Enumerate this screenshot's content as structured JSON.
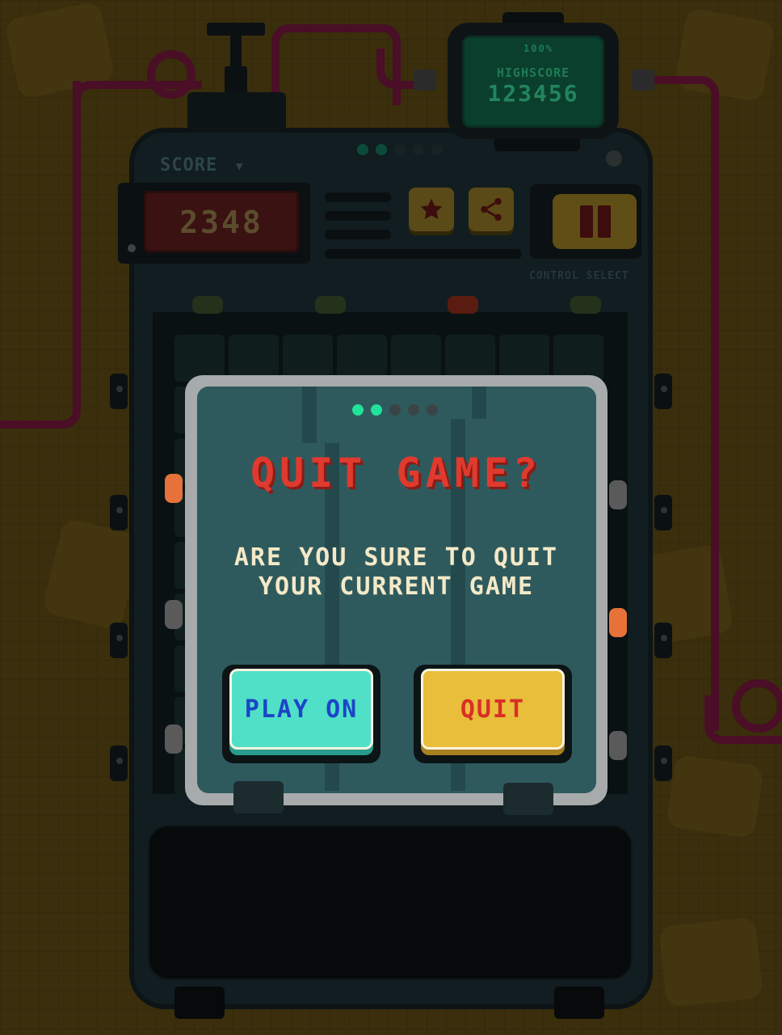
{
  "highscore": {
    "label": "HIGHSCORE",
    "value": "123456",
    "battery": "100%"
  },
  "score": {
    "label": "SCORE",
    "value": "2348"
  },
  "controls": {
    "control_select_label": "CONTROL SELECT",
    "star_icon": "star-icon",
    "share_icon": "share-icon",
    "pause_icon": "pause-icon"
  },
  "modal": {
    "title": "QUIT GAME?",
    "message_line1": "ARE YOU SURE TO QUIT",
    "message_line2": "YOUR CURRENT GAME",
    "play_on_label": "PLAY ON",
    "quit_label": "QUIT",
    "progress_dots_total": 5,
    "progress_dots_active": 2
  },
  "colors": {
    "title_red": "#e03a2e",
    "play_on_teal": "#4fe0c7",
    "quit_yellow": "#e8be3a",
    "dot_active": "#1fe39a"
  }
}
